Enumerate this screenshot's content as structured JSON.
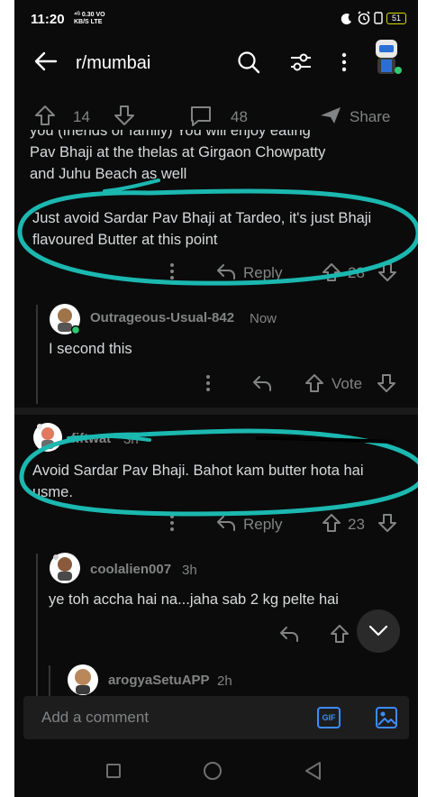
{
  "status_bar": {
    "time": "11:20",
    "net_line1": "⁴ᴳ 0.30 VO",
    "net_line2": "KB/S LTE",
    "battery": "51"
  },
  "header": {
    "subreddit": "r/mumbai"
  },
  "post_actions": {
    "upvotes": "14",
    "comments": "48",
    "share_label": "Share"
  },
  "parent_comment": {
    "partial_line": "you (friends or family) You will enjoy eating",
    "line2": "Pav Bhaji at the thelas at Girgaon Chowpatty",
    "line3": "and Juhu Beach as well",
    "paragraph2": "Just avoid Sardar Pav Bhaji at Tardeo, it's just Bhaji flavoured Butter at this point",
    "reply_label": "Reply",
    "score": "28"
  },
  "reply_1": {
    "username": "Outrageous-Usual-842",
    "time": "Now",
    "text": "I second this",
    "vote_label": "Vote"
  },
  "comment_2": {
    "username": "fiftwat",
    "time": "3h",
    "text": "Avoid Sardar Pav Bhaji. Bahot kam butter hota hai usme.",
    "reply_label": "Reply",
    "score": "23"
  },
  "reply_2": {
    "username": "coolalien007",
    "time": "3h",
    "text": "ye toh accha hai na...jaha sab 2 kg pelte hai"
  },
  "reply_3": {
    "username": "arogyaSetuAPP",
    "time": "2h"
  },
  "comment_input": {
    "placeholder": "Add a comment",
    "gif_label": "GIF"
  },
  "colors": {
    "background": "#0b0b0b",
    "text": "#d7dadc",
    "muted": "#818384",
    "annotation": "#1bb8b0"
  }
}
